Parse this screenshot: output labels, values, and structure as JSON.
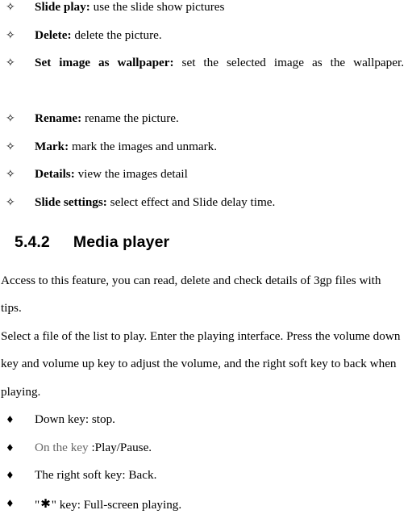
{
  "document": {
    "picture_options_list": {
      "bullet_glyph": "✧",
      "bullet_name": "hollow-four-point-star-bullet",
      "items": [
        {
          "term": "Slide play:",
          "desc": " use the slide show pictures",
          "justified": false
        },
        {
          "term": "Delete:",
          "desc": " delete the picture.",
          "justified": false
        },
        {
          "term": "Set image as wallpaper:",
          "desc": " set the selected image as the wallpaper.",
          "justified": true
        },
        {
          "term": "Rename:",
          "desc": " rename the picture.",
          "justified": false
        },
        {
          "term": "Mark:",
          "desc": " mark the images and unmark.",
          "justified": false
        },
        {
          "term": "Details:",
          "desc": " view the images detail",
          "justified": false
        },
        {
          "term": "Slide settings:",
          "desc": " select effect and Slide delay time.",
          "justified": false
        }
      ]
    },
    "section_heading": {
      "number": "5.4.2",
      "title": "Media player"
    },
    "paragraphs": [
      "Access to this feature, you can read, delete and check details of 3gp files with tips.",
      "Select a file of the list to play. Enter the playing interface. Press the volume down key and volume up key to adjust the volume, and the right soft key to back when playing."
    ],
    "key_controls_list": {
      "bullet_glyph": "♦",
      "bullet_name": "filled-diamond-bullet",
      "items": [
        {
          "pre": "",
          "gray_text": "",
          "text": "Down key: stop.",
          "has_star": false
        },
        {
          "pre": "",
          "gray_text": "On the key ",
          "text": ":Play/Pause.",
          "has_star": false
        },
        {
          "pre": "",
          "gray_text": "",
          "text": "The right soft key: Back.",
          "has_star": false
        },
        {
          "pre": "\"",
          "gray_text": "",
          "star_glyph": "✱",
          "text": "\" key: Full-screen playing.",
          "has_star": true
        }
      ]
    },
    "colors": {
      "text": "#000000",
      "muted_text": "#666666",
      "background": "#ffffff"
    }
  }
}
